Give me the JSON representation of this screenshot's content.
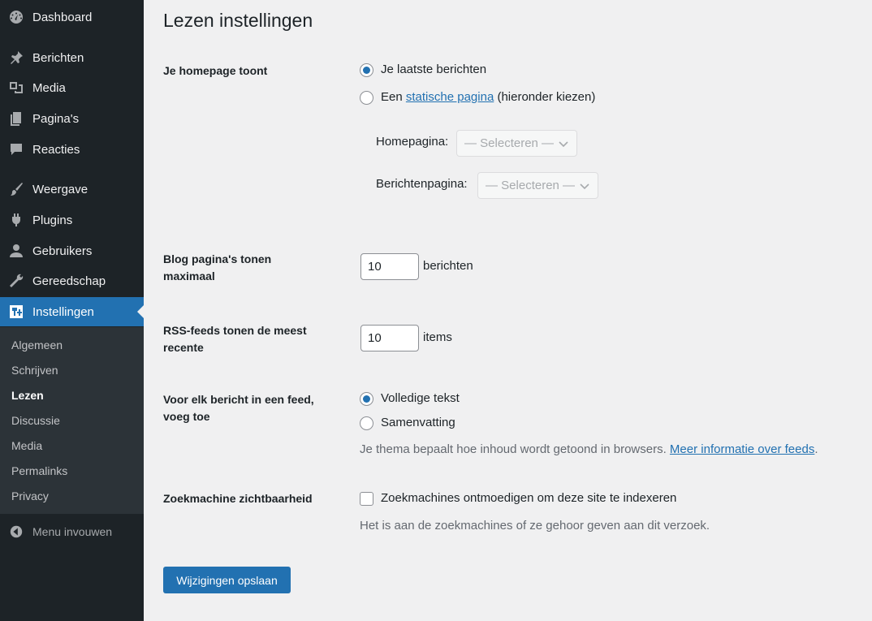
{
  "sidebar": {
    "items": [
      {
        "label": "Dashboard",
        "icon": "dashboard-icon"
      },
      {
        "label": "Berichten",
        "icon": "pin-icon"
      },
      {
        "label": "Media",
        "icon": "media-icon"
      },
      {
        "label": "Pagina's",
        "icon": "pages-icon"
      },
      {
        "label": "Reacties",
        "icon": "comments-icon"
      },
      {
        "label": "Weergave",
        "icon": "brush-icon"
      },
      {
        "label": "Plugins",
        "icon": "plugin-icon"
      },
      {
        "label": "Gebruikers",
        "icon": "user-icon"
      },
      {
        "label": "Gereedschap",
        "icon": "wrench-icon"
      },
      {
        "label": "Instellingen",
        "icon": "settings-icon"
      }
    ],
    "submenu": [
      "Algemeen",
      "Schrijven",
      "Lezen",
      "Discussie",
      "Media",
      "Permalinks",
      "Privacy"
    ],
    "collapse_label": "Menu invouwen"
  },
  "page": {
    "title": "Lezen instellingen",
    "homepage": {
      "label": "Je homepage toont",
      "option_latest": "Je laatste berichten",
      "option_static_prefix": "Een",
      "option_static_link": "statische pagina",
      "option_static_suffix": "(hieronder kiezen)",
      "homepage_label": "Homepagina:",
      "posts_page_label": "Berichtenpagina:",
      "select_placeholder": "— Selecteren —"
    },
    "blog_pages": {
      "label": "Blog pagina's tonen maximaal",
      "value": "10",
      "suffix": "berichten"
    },
    "rss": {
      "label": "RSS-feeds tonen de meest recente",
      "value": "10",
      "suffix": "items"
    },
    "feed_content": {
      "label": "Voor elk bericht in een feed, voeg toe",
      "option_full": "Volledige tekst",
      "option_summary": "Samenvatting",
      "desc_prefix": "Je thema bepaalt hoe inhoud wordt getoond in browsers.",
      "desc_link": "Meer informatie over feeds",
      "desc_suffix": "."
    },
    "search_visibility": {
      "label": "Zoekmachine zichtbaarheid",
      "checkbox_label": "Zoekmachines ontmoedigen om deze site te indexeren",
      "desc": "Het is aan de zoekmachines of ze gehoor geven aan dit verzoek."
    },
    "save_label": "Wijzigingen opslaan"
  },
  "colors": {
    "sidebar_bg": "#1d2327",
    "accent": "#2271b1",
    "page_bg": "#f0f0f1"
  }
}
